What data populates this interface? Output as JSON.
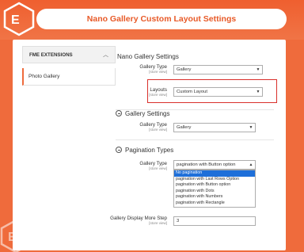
{
  "header": {
    "title": "Nano Gallery Custom Layout Settings",
    "logo_icon": "fme-logo-icon"
  },
  "sidebar": {
    "section_title": "FME EXTENSIONS",
    "items": [
      {
        "label": "Photo Gallery"
      }
    ]
  },
  "main": {
    "section_title": "Nano Gallery Settings",
    "fields": {
      "gallery_type": {
        "label": "Gallery Type",
        "scope": "[store view]",
        "value": "Gallery"
      },
      "layouts": {
        "label": "Layouts",
        "scope": "[store view]",
        "value": "Custom Layout"
      }
    },
    "gallery_settings": {
      "title": "Gallery Settings",
      "gallery_type": {
        "label": "Gallery Type",
        "scope": "[store view]",
        "value": "Gallery"
      }
    },
    "pagination_types": {
      "title": "Pagination Types",
      "gallery_type": {
        "label": "Gallery Type",
        "scope": "[store view]",
        "value": "pagination with Button option",
        "options": [
          "No pagination",
          "pagination with Last Rows Option",
          "pagination with Button option",
          "pagination with Dots",
          "pagination with Numbers",
          "pagination with Rectangle"
        ],
        "selected_index": 0
      },
      "display_more_step": {
        "label": "Gallery Display More Step",
        "scope": "[store view]",
        "value": "3"
      }
    }
  },
  "colors": {
    "brand_orange": "#ef6b3c",
    "highlight_red": "#d9302b",
    "selected_blue": "#1e6fd9"
  }
}
